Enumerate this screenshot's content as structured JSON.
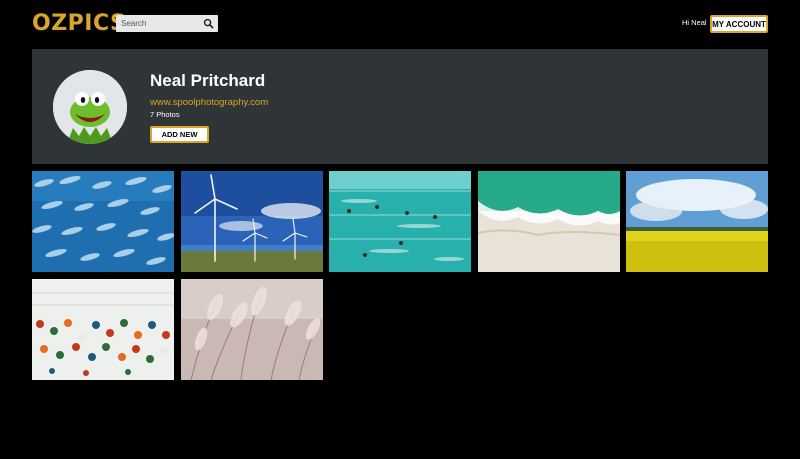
{
  "header": {
    "logo": "OZPICS",
    "search_placeholder": "Search",
    "greeting": "Hi Neal",
    "account_label": "MY ACCOUNT"
  },
  "profile": {
    "name": "Neal Pritchard",
    "website": "www.spoolphotography.com",
    "photo_count": "7 Photos",
    "add_label": "ADD NEW"
  },
  "photos": [
    {
      "subject": "school of fish"
    },
    {
      "subject": "wind turbines"
    },
    {
      "subject": "swimmers in pool"
    },
    {
      "subject": "aerial beach waves"
    },
    {
      "subject": "canola field"
    },
    {
      "subject": "colorful wall knobs"
    },
    {
      "subject": "pampas grass"
    }
  ],
  "colors": {
    "accent": "#d9a52b",
    "panel": "#2f3536",
    "background": "#000000"
  },
  "icons": {
    "search": "search-icon"
  }
}
